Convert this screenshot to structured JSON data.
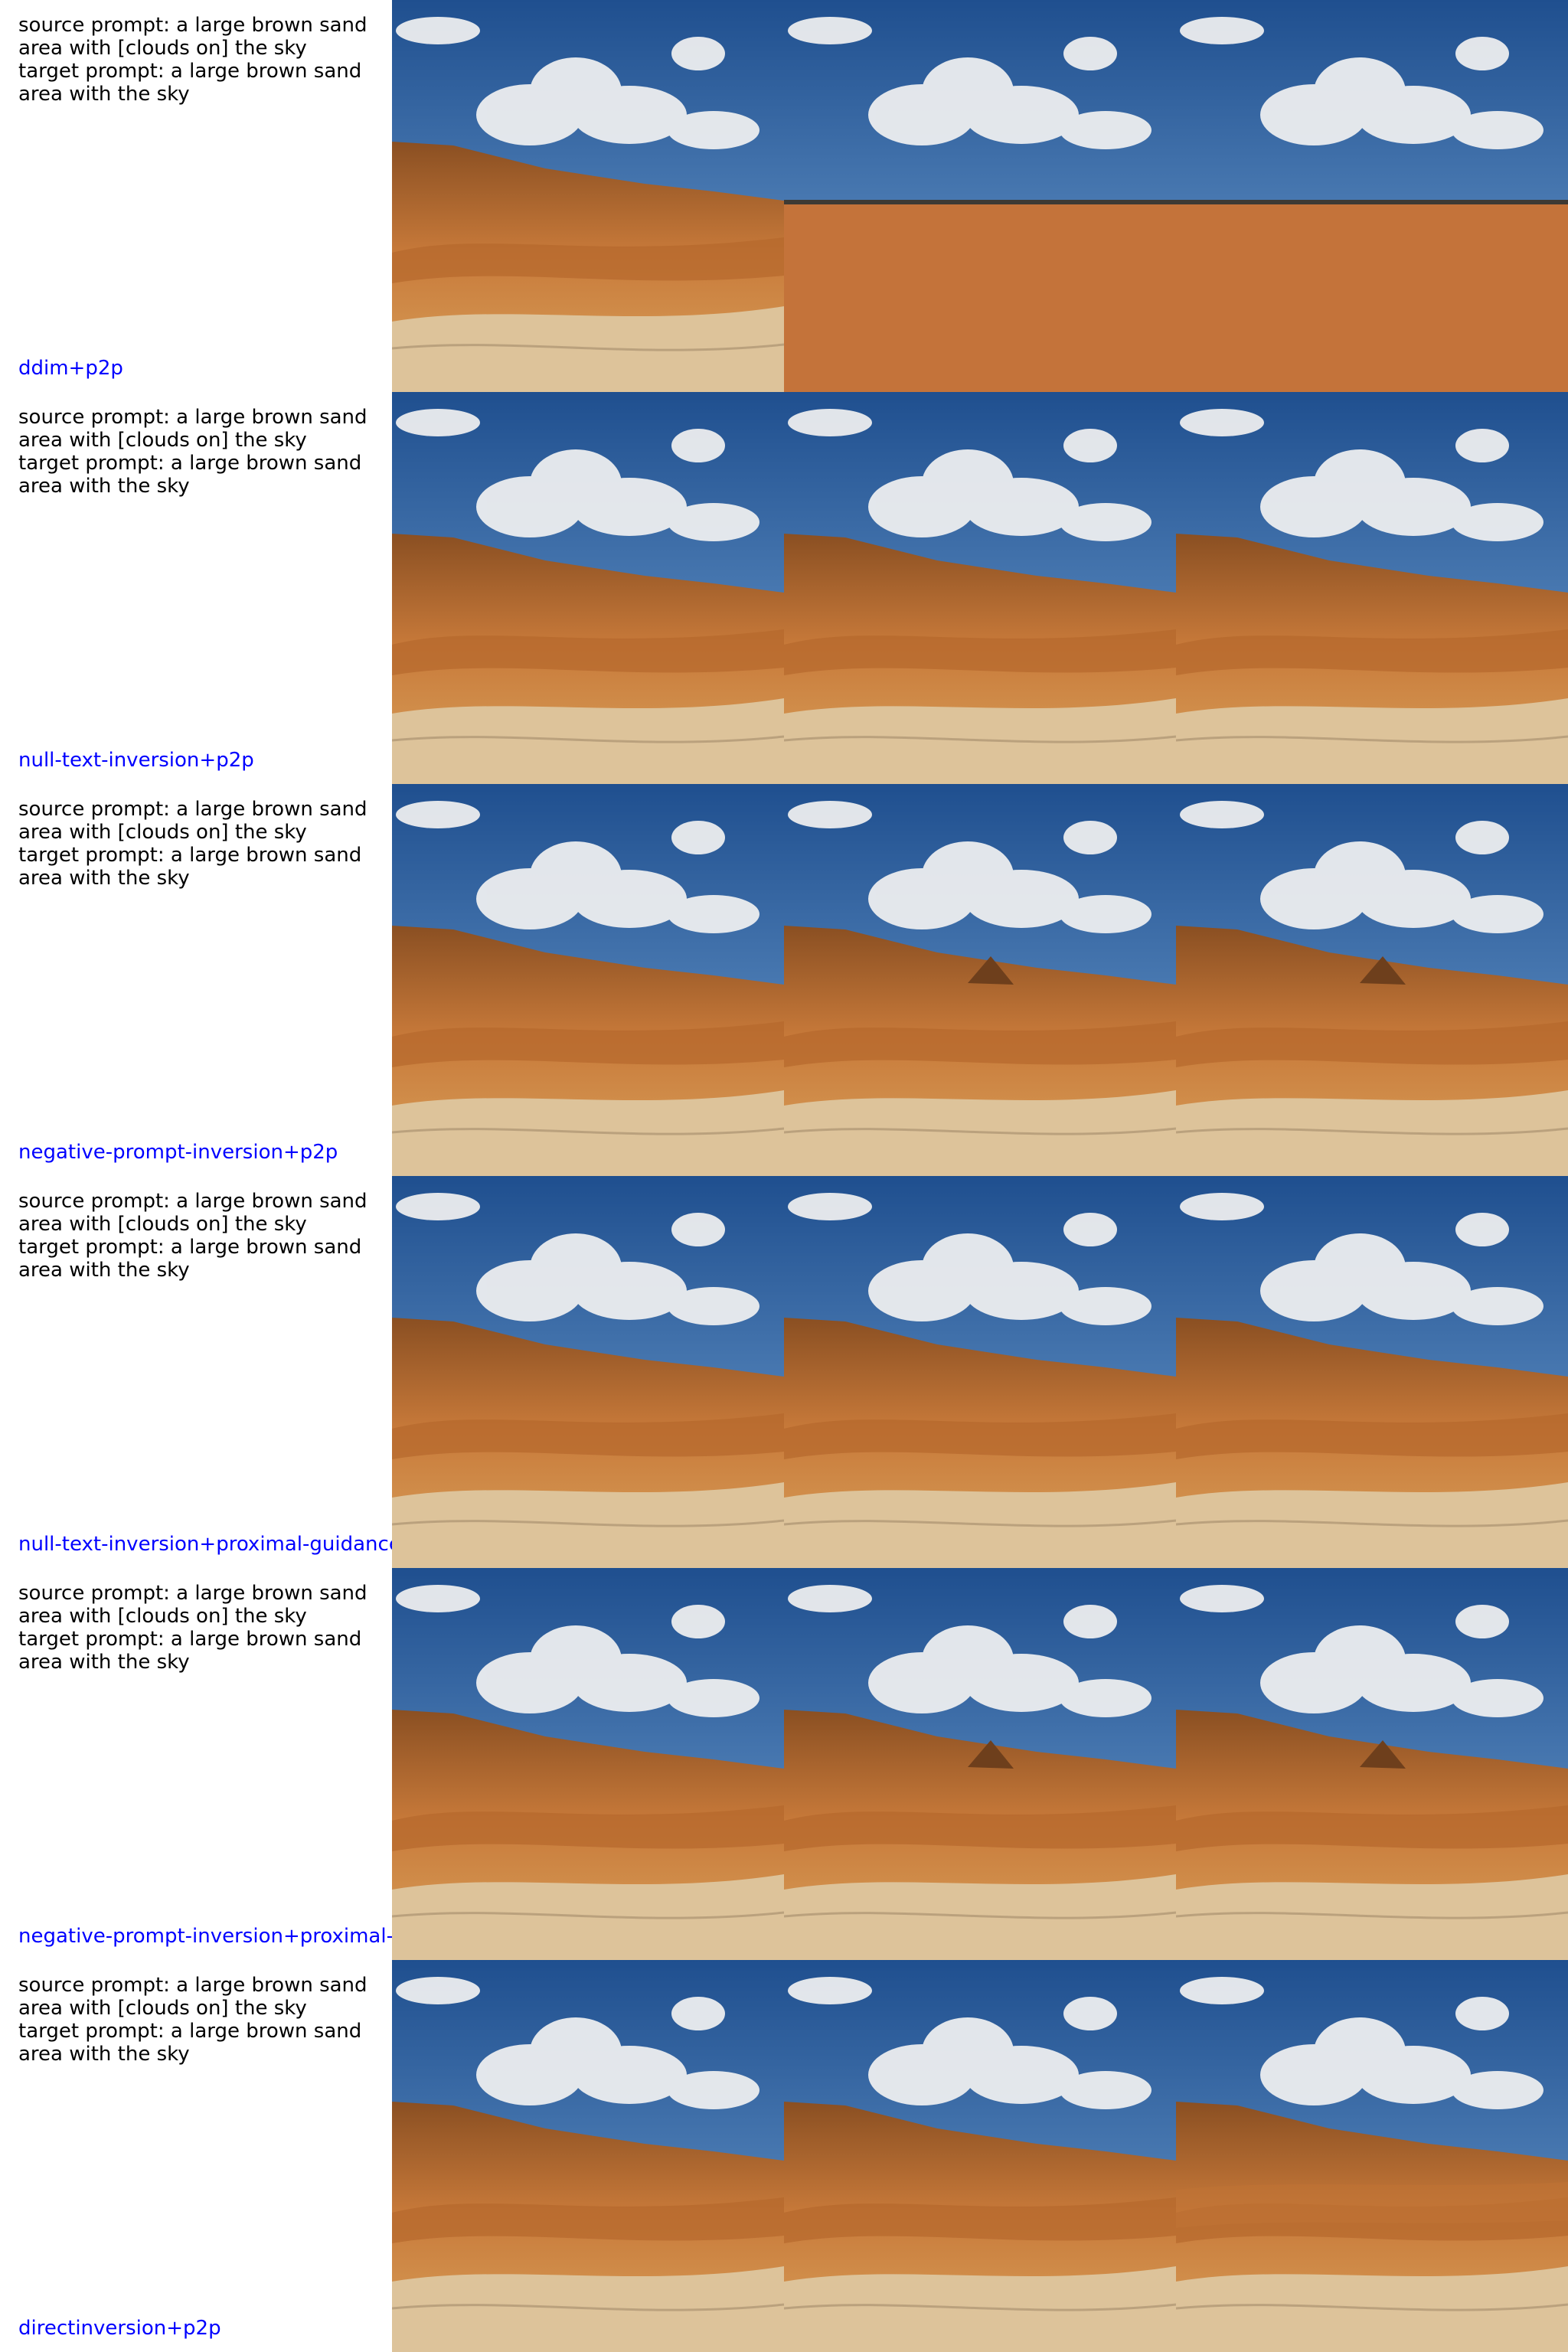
{
  "rows": [
    {
      "source_prompt": "source prompt: a large brown sand area with [clouds on] the sky",
      "target_prompt": "target prompt: a large brown sand area with the sky",
      "method": "ddim+p2p",
      "images": [
        "hillside-desert-source",
        "flat-desert-edit",
        "flat-desert-edit"
      ]
    },
    {
      "source_prompt": "source prompt: a large brown sand area with [clouds on] the sky",
      "target_prompt": "target prompt: a large brown sand area with the sky",
      "method": "null-text-inversion+p2p",
      "images": [
        "hillside-desert-source",
        "hillside-desert-edit",
        "hillside-desert-edit"
      ]
    },
    {
      "source_prompt": "source prompt: a large brown sand area with [clouds on] the sky",
      "target_prompt": "target prompt: a large brown sand area with the sky",
      "method": "negative-prompt-inversion+p2p",
      "images": [
        "hillside-desert-source",
        "hillside-desert-peak",
        "hillside-desert-peak"
      ]
    },
    {
      "source_prompt": "source prompt: a large brown sand area with [clouds on] the sky",
      "target_prompt": "target prompt: a large brown sand area with the sky",
      "method": "null-text-inversion+proximal-guidance",
      "images": [
        "hillside-desert-source",
        "hillside-desert-edit",
        "hillside-desert-edit"
      ]
    },
    {
      "source_prompt": "source prompt: a large brown sand area with [clouds on] the sky",
      "target_prompt": "target prompt: a large brown sand area with the sky",
      "method": "negative-prompt-inversion+proximal-g",
      "images": [
        "hillside-desert-source",
        "hillside-desert-peak",
        "hillside-desert-peak"
      ]
    },
    {
      "source_prompt": "source prompt: a large brown sand area with [clouds on] the sky",
      "target_prompt": "target prompt: a large brown sand area with the sky",
      "method": "directinversion+p2p",
      "images": [
        "hillside-desert-source",
        "hillside-desert-edit",
        "hillside-desert-smooth"
      ]
    }
  ],
  "colors": {
    "prompt_text": "#000000",
    "method_text": "#0000ff",
    "sky_top": "#1f4f8f",
    "sky_bottom": "#6f9fd0",
    "sand": "#c87a3a",
    "sand_dark": "#8a4f22",
    "cloud": "#f2f2f2"
  }
}
